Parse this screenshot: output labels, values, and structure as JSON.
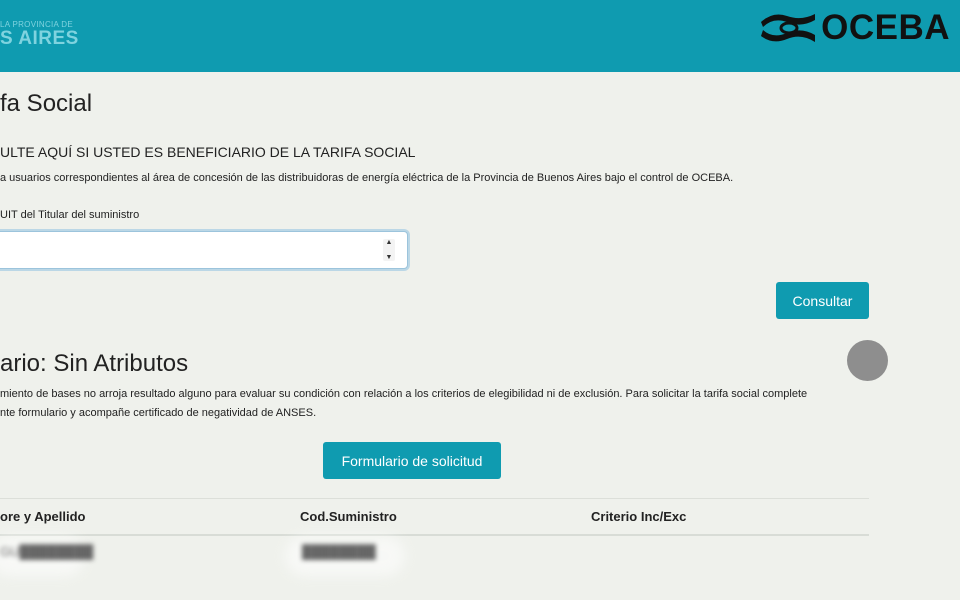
{
  "header": {
    "province_logo_small": "LA PROVINCIA DE",
    "province_logo_big": "S AIRES",
    "brand_name": "OCEBA"
  },
  "main": {
    "title": "fa Social",
    "subtitle": "ULTE AQUÍ SI USTED ES BENEFICIARIO DE LA TARIFA SOCIAL",
    "description": "a usuarios correspondientes al área de concesión de las distribuidoras de energía eléctrica de la Provincia de Buenos Aires bajo el control de OCEBA.",
    "cuit_label": "UIT del Titular del suministro",
    "cuit_value": "",
    "consultar_label": "Consultar"
  },
  "result": {
    "title": "ario: Sin Atributos",
    "paragraph_line1": "miento de bases no arroja resultado alguno para evaluar su condición con relación a los criterios de elegibilidad ni de exclusión. Para solicitar la tarifa social complete",
    "paragraph_line2": "nte formulario y acompañe certificado de negatividad de ANSES.",
    "form_button_label": "Formulario de solicitud",
    "table": {
      "headers": [
        "ore y Apellido",
        "Cod.Suministro",
        "Criterio Inc/Exc"
      ],
      "rows": [
        [
          "GU████████",
          "████████",
          ""
        ]
      ]
    }
  },
  "colors": {
    "header_bg": "#0f9bb0",
    "button_bg": "#0f9bb0",
    "page_bg": "#eff1ec"
  }
}
